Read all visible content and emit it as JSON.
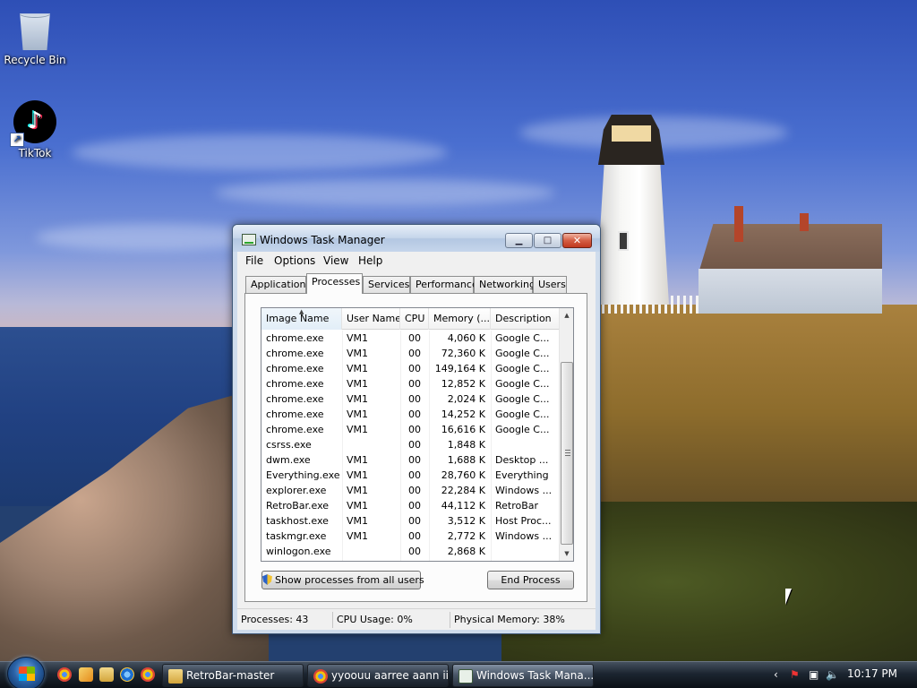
{
  "desktop": {
    "icons": [
      {
        "label": "Recycle Bin",
        "icon": "recycle-bin-icon"
      },
      {
        "label": "TikTok",
        "icon": "tiktok-icon"
      }
    ]
  },
  "window": {
    "title": "Windows Task Manager",
    "caption": {
      "minimize": "▁",
      "maximize": "□",
      "close": "✕"
    },
    "menu": [
      "File",
      "Options",
      "View",
      "Help"
    ],
    "tabs": [
      "Applications",
      "Processes",
      "Services",
      "Performance",
      "Networking",
      "Users"
    ],
    "active_tab": "Processes",
    "columns": [
      "Image Name",
      "User Name",
      "CPU",
      "Memory (...",
      "Description"
    ],
    "sorted_column": "Image Name",
    "rows": [
      {
        "image": "chrome.exe",
        "user": "VM1",
        "cpu": "00",
        "memory": "4,060 K",
        "desc": "Google C..."
      },
      {
        "image": "chrome.exe",
        "user": "VM1",
        "cpu": "00",
        "memory": "72,360 K",
        "desc": "Google C..."
      },
      {
        "image": "chrome.exe",
        "user": "VM1",
        "cpu": "00",
        "memory": "149,164 K",
        "desc": "Google C..."
      },
      {
        "image": "chrome.exe",
        "user": "VM1",
        "cpu": "00",
        "memory": "12,852 K",
        "desc": "Google C..."
      },
      {
        "image": "chrome.exe",
        "user": "VM1",
        "cpu": "00",
        "memory": "2,024 K",
        "desc": "Google C..."
      },
      {
        "image": "chrome.exe",
        "user": "VM1",
        "cpu": "00",
        "memory": "14,252 K",
        "desc": "Google C..."
      },
      {
        "image": "chrome.exe",
        "user": "VM1",
        "cpu": "00",
        "memory": "16,616 K",
        "desc": "Google C..."
      },
      {
        "image": "csrss.exe",
        "user": "",
        "cpu": "00",
        "memory": "1,848 K",
        "desc": ""
      },
      {
        "image": "dwm.exe",
        "user": "VM1",
        "cpu": "00",
        "memory": "1,688 K",
        "desc": "Desktop ..."
      },
      {
        "image": "Everything.exe",
        "user": "VM1",
        "cpu": "00",
        "memory": "28,760 K",
        "desc": "Everything"
      },
      {
        "image": "explorer.exe",
        "user": "VM1",
        "cpu": "00",
        "memory": "22,284 K",
        "desc": "Windows ..."
      },
      {
        "image": "RetroBar.exe",
        "user": "VM1",
        "cpu": "00",
        "memory": "44,112 K",
        "desc": "RetroBar"
      },
      {
        "image": "taskhost.exe",
        "user": "VM1",
        "cpu": "00",
        "memory": "3,512 K",
        "desc": "Host Proc..."
      },
      {
        "image": "taskmgr.exe",
        "user": "VM1",
        "cpu": "00",
        "memory": "2,772 K",
        "desc": "Windows ..."
      },
      {
        "image": "winlogon.exe",
        "user": "",
        "cpu": "00",
        "memory": "2,868 K",
        "desc": ""
      }
    ],
    "buttons": {
      "show_all": "Show processes from all users",
      "end_process": "End Process"
    },
    "status": {
      "processes": "Processes: 43",
      "cpu": "CPU Usage: 0%",
      "memory": "Physical Memory: 38%"
    }
  },
  "taskbar": {
    "quick_launch": [
      "chrome-icon",
      "media-player-icon",
      "folder-icon",
      "internet-explorer-icon",
      "chrome-icon"
    ],
    "tasks": [
      {
        "label": "RetroBar-master",
        "icon": "folder-icon",
        "active": false
      },
      {
        "label": "yyoouu aarree aann ii...",
        "icon": "chrome-icon",
        "active": false
      },
      {
        "label": "Windows Task Mana...",
        "icon": "task-manager-icon",
        "active": true
      }
    ],
    "tray": {
      "clock": "10:17 PM"
    }
  }
}
